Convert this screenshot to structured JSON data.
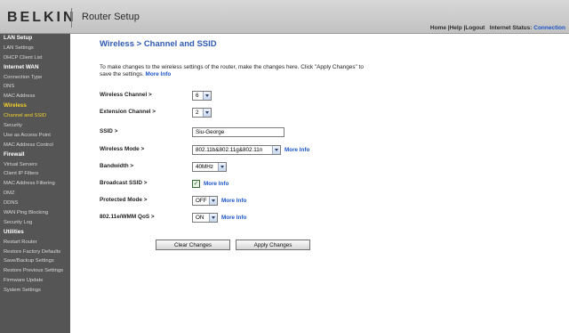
{
  "header": {
    "brand": "BELKIN",
    "title": "Router Setup",
    "links": {
      "home": "Home",
      "help": "Help",
      "logout": "Logout",
      "sep": "|"
    },
    "status_label": "Internet Status:",
    "status_value": "Connection"
  },
  "sidebar": {
    "items": [
      {
        "label": "LAN Setup",
        "kind": "section"
      },
      {
        "label": "LAN Settings",
        "kind": "item"
      },
      {
        "label": "DHCP Client List",
        "kind": "item"
      },
      {
        "label": "Internet WAN",
        "kind": "section"
      },
      {
        "label": "Connection Type",
        "kind": "item"
      },
      {
        "label": "DNS",
        "kind": "item"
      },
      {
        "label": "MAC Address",
        "kind": "item"
      },
      {
        "label": "Wireless",
        "kind": "active-section"
      },
      {
        "label": "Channel and SSID",
        "kind": "active-item"
      },
      {
        "label": "Security",
        "kind": "item"
      },
      {
        "label": "Use as Access Point",
        "kind": "item"
      },
      {
        "label": "MAC Address Control",
        "kind": "item"
      },
      {
        "label": "Firewall",
        "kind": "section"
      },
      {
        "label": "Virtual Servers",
        "kind": "item"
      },
      {
        "label": "Client IP Filters",
        "kind": "item"
      },
      {
        "label": "MAC Address Filtering",
        "kind": "item"
      },
      {
        "label": "DMZ",
        "kind": "item"
      },
      {
        "label": "DDNS",
        "kind": "item"
      },
      {
        "label": "WAN Ping Blocking",
        "kind": "item"
      },
      {
        "label": "Security Log",
        "kind": "item"
      },
      {
        "label": "Utilities",
        "kind": "section"
      },
      {
        "label": "Restart Router",
        "kind": "item"
      },
      {
        "label": "Restore Factory Defaults",
        "kind": "item"
      },
      {
        "label": "Save/Backup Settings",
        "kind": "item"
      },
      {
        "label": "Restore Previous Settings",
        "kind": "item"
      },
      {
        "label": "Firmware Update",
        "kind": "item"
      },
      {
        "label": "System Settings",
        "kind": "item"
      }
    ]
  },
  "main": {
    "title": "Wireless > Channel and SSID",
    "intro": "To make changes to the wireless settings of the router, make the changes here. Click \"Apply Changes\" to save the settings.",
    "intro_more": "More Info",
    "fields": {
      "channel": {
        "label": "Wireless Channel >",
        "value": "6"
      },
      "ext_channel": {
        "label": "Extension Channel >",
        "value": "2"
      },
      "ssid": {
        "label": "SSID >",
        "value": "Siu-George"
      },
      "mode": {
        "label": "Wireless Mode >",
        "value": "802.11b&802.11g&802.11n",
        "more": "More Info"
      },
      "bandwidth": {
        "label": "Bandwidth >",
        "value": "40MHz"
      },
      "broadcast": {
        "label": "Broadcast SSID >",
        "checked": true,
        "more": "More Info"
      },
      "protected": {
        "label": "Protected Mode >",
        "value": "OFF",
        "more": "More Info"
      },
      "wmm": {
        "label": "802.11e/WMM QoS >",
        "value": "ON",
        "more": "More Info"
      }
    },
    "buttons": {
      "clear": "Clear Changes",
      "apply": "Apply Changes"
    }
  },
  "colors": {
    "link": "#1c55c8",
    "title": "#2f5bb3",
    "sidebar_bg": "#555555",
    "active_nav": "#f4d229"
  }
}
